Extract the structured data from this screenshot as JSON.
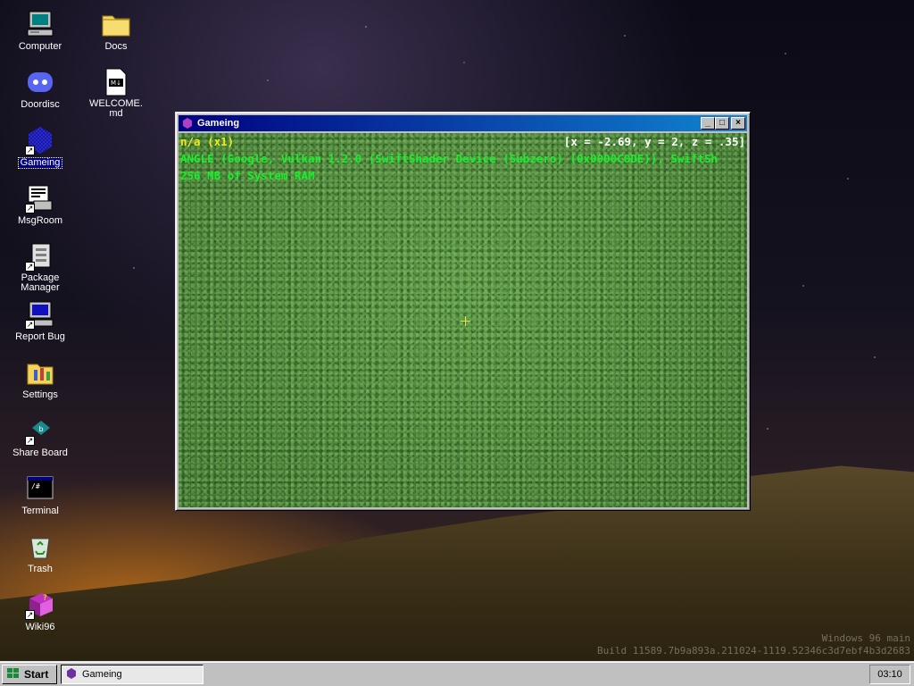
{
  "desktop": {
    "icons": [
      {
        "label": "Computer",
        "icon": "computer-icon"
      },
      {
        "label": "Docs",
        "icon": "folder-icon"
      },
      {
        "label": "Doordisc",
        "icon": "discord-icon"
      },
      {
        "label": "WELCOME.md",
        "icon": "markdown-file-icon"
      },
      {
        "label": "Gameing",
        "icon": "game-icon"
      },
      {
        "label": "MsgRoom",
        "icon": "msgroom-icon"
      },
      {
        "label": "Package Manager",
        "icon": "package-manager-icon"
      },
      {
        "label": "Report Bug",
        "icon": "report-bug-icon"
      },
      {
        "label": "Settings",
        "icon": "settings-icon"
      },
      {
        "label": "Share Board",
        "icon": "share-board-icon"
      },
      {
        "label": "Terminal",
        "icon": "terminal-icon"
      },
      {
        "label": "Trash",
        "icon": "trash-icon"
      },
      {
        "label": "Wiki96",
        "icon": "wiki-icon"
      }
    ],
    "watermark": {
      "line1": "Windows 96 main",
      "line2": "Build 11589.7b9a893a.211024-1119.52346c3d7ebf4b3d2683"
    }
  },
  "window": {
    "title": "Gameing",
    "hud": {
      "status": "n/a (x1)",
      "coords": "[x = -2.69, y = 2, z = .35]",
      "renderer": "ANGLE (Google, Vulkan 1.2.0 (SwiftShader Device (Subzero) (0x0000C0DE)), SwiftSh",
      "memory": "256 MB of System RAM"
    },
    "buttons": {
      "minimize": "_",
      "maximize": "□",
      "close": "×"
    }
  },
  "taskbar": {
    "start_label": "Start",
    "task_label": "Gameing",
    "clock": "03:10"
  },
  "colors": {
    "titlebar_start": "#000080",
    "titlebar_end": "#1084d0",
    "hud_yellow": "#f2e71a",
    "hud_green": "#19ef2d"
  }
}
